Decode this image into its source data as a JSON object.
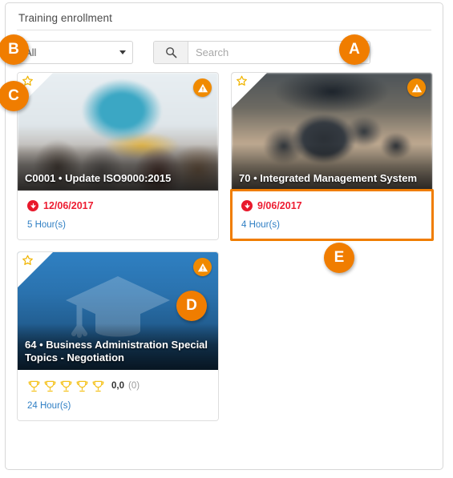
{
  "panel": {
    "title": "Training enrollment"
  },
  "toolbar": {
    "filter": {
      "selected": "All",
      "caret_icon": "chevron-down-icon"
    },
    "search": {
      "placeholder": "Search",
      "value": "",
      "icon": "search-icon"
    }
  },
  "cards": [
    {
      "id": "card-1",
      "title": "C0001 • Update ISO9000:2015",
      "image": "classroom-photo",
      "favorite_icon": "star-icon",
      "warning_icon": "warning-icon",
      "date": "12/06/2017",
      "date_icon": "down-arrow-circle-icon",
      "hours": "5 Hour(s)",
      "highlighted": false,
      "rating": null
    },
    {
      "id": "card-2",
      "title": "70 • Integrated Management System",
      "image": "gears-photo",
      "favorite_icon": "star-icon",
      "warning_icon": "warning-icon",
      "date": "9/06/2017",
      "date_icon": "down-arrow-circle-icon",
      "hours": "4 Hour(s)",
      "highlighted": true,
      "rating": null
    },
    {
      "id": "card-3",
      "title": "64 • Business Administration Special Topics - Negotiation",
      "image": "graduation-cap-placeholder",
      "favorite_icon": "star-icon",
      "warning_icon": "warning-icon",
      "date": null,
      "hours": "24 Hour(s)",
      "highlighted": false,
      "rating": {
        "icon": "trophy-icon",
        "max": 5,
        "filled": 0,
        "value": "0,0",
        "count": "(0)"
      }
    }
  ],
  "callouts": [
    {
      "id": "badge-a",
      "label": "A"
    },
    {
      "id": "badge-b",
      "label": "B"
    },
    {
      "id": "badge-c",
      "label": "C"
    },
    {
      "id": "badge-d",
      "label": "D"
    },
    {
      "id": "badge-e",
      "label": "E"
    }
  ],
  "colors": {
    "accent_orange": "#f07d00",
    "date_red": "#ed1c31",
    "link_blue": "#2f7fc4",
    "trophy_gold": "#f5c21b"
  }
}
